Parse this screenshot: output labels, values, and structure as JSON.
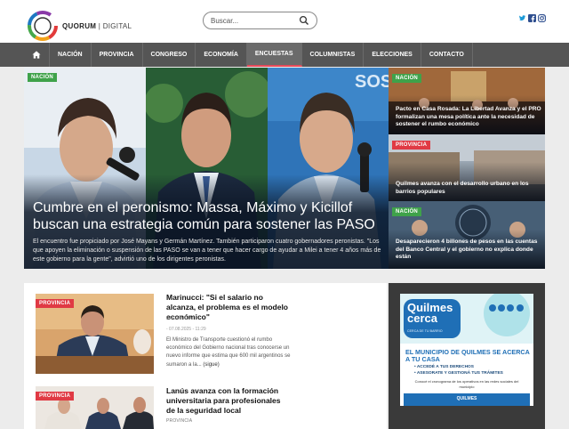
{
  "brand": {
    "name_bold": "QUORUM",
    "name_light": "DIGITAL"
  },
  "search": {
    "placeholder": "Buscar..."
  },
  "nav": {
    "items": [
      "NACIÓN",
      "PROVINCIA",
      "CONGRESO",
      "ECONOMÍA",
      "ENCUESTAS",
      "COLUMNISTAS",
      "ELECCIONES",
      "CONTACTO"
    ],
    "active": "ENCUESTAS"
  },
  "hero": {
    "badge": "NACIÓN",
    "title": "Cumbre en el peronismo: Massa, Máximo y Kicillof buscan una estrategia común para sostener las PASO",
    "summary": "El encuentro fue propiciado por José Mayans y Germán Martínez. También participaron cuatro gobernadores peronistas. \"Los que apoyen la eliminación o suspensión de las PASO se van a tener que hacer cargo de ayudar a Milei a tener 4 años más de este gobierno para la gente\", advirtió uno de los dirigentes peronistas."
  },
  "side_stories": [
    {
      "badge": "NACIÓN",
      "title": "Pacto en Casa Rosada: La Libertad Avanza y el PRO formalizan una mesa política ante la necesidad de sostener el rumbo económico"
    },
    {
      "badge": "PROVINCIA",
      "title": "Quilmes avanza con el desarrollo urbano en los barrios populares"
    },
    {
      "badge": "NACIÓN",
      "title": "Desaparecieron 4 billones de pesos en las cuentas del Banco Central y el gobierno no explica donde están"
    }
  ],
  "articles": [
    {
      "badge": "PROVINCIA",
      "title": "Marinucci: \"Si el salario no alcanza, el problema es el modelo económico\"",
      "category": "PROVINCIA",
      "date": "- 07.08.2025 - 11:29",
      "body": "El Ministro de Transporte cuestionó el rumbo económico del Gobierno nacional tras conocerse un nuevo informe que estima que 600 mil argentinos se sumaron a la...",
      "more": "(sigue)"
    },
    {
      "badge": "PROVINCIA",
      "title": "Lanús avanza con la formación universitaria para profesionales de la seguridad local",
      "category": "PROVINCIA"
    }
  ],
  "ad": {
    "headline": "Quilmes cerca",
    "tagline": "CERCA DE TU BARRIO",
    "title": "EL MUNICIPIO DE QUILMES SE ACERCA A TU CASA",
    "bullets": [
      "• ACCEDÉ A TUS DERECHOS",
      "• ASESORATE Y GESTIONÁ TUS TRÁMITES"
    ],
    "note": "Conocé el cronograma de los operativos en las redes sociales del municipio",
    "footer": "QUILMES"
  },
  "colors": {
    "nav_bg": "#555555",
    "accent_green": "#3fa24a",
    "accent_red": "#e03a44",
    "ad_blue": "#1f6fb6"
  }
}
